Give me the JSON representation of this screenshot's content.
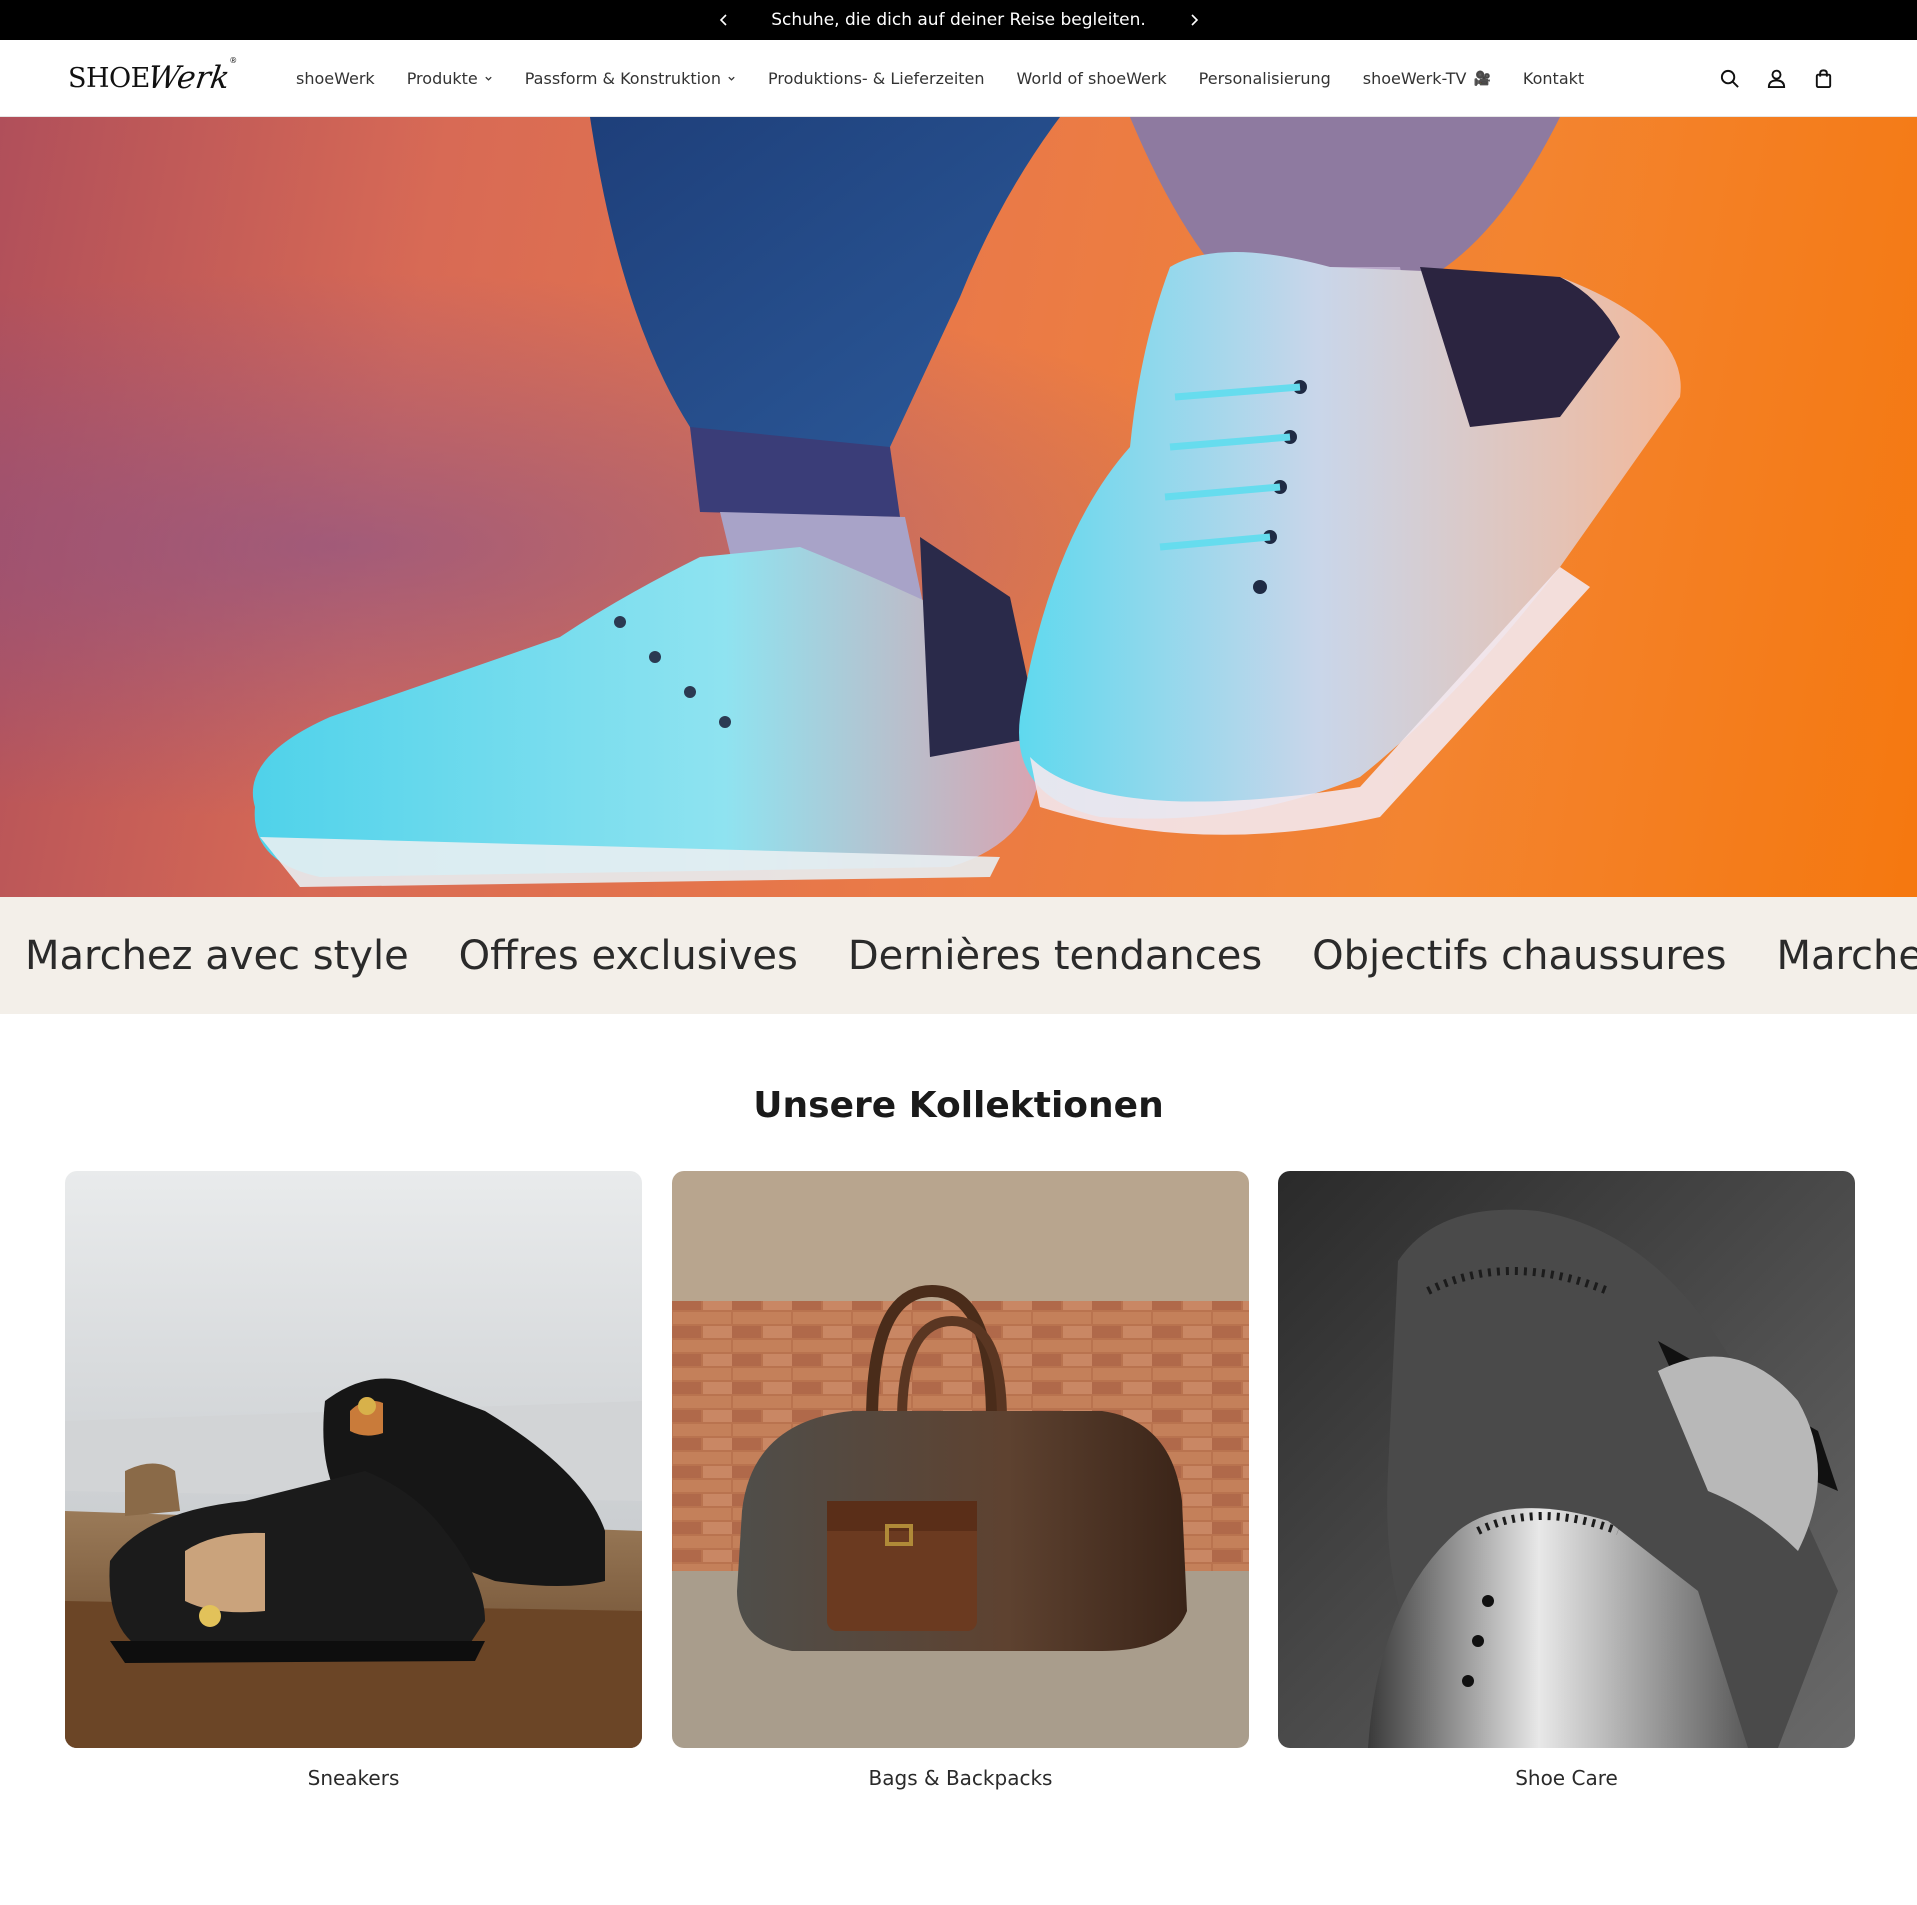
{
  "announcement": {
    "text": "Schuhe, die dich auf deiner Reise begleiten."
  },
  "header": {
    "logo_main": "SHOE",
    "logo_script": "Werk",
    "logo_mark": "®",
    "nav": [
      {
        "label": "shoeWerk",
        "dropdown": false
      },
      {
        "label": "Produkte",
        "dropdown": true
      },
      {
        "label": "Passform & Konstruktion",
        "dropdown": true
      },
      {
        "label": "Produktions- & Lieferzeiten",
        "dropdown": false
      },
      {
        "label": "World of shoeWerk",
        "dropdown": false
      },
      {
        "label": "Personalisierung",
        "dropdown": false
      },
      {
        "label": "shoeWerk-TV",
        "dropdown": false,
        "suffix_glyph": "🎥"
      },
      {
        "label": "Kontakt",
        "dropdown": false
      }
    ],
    "icons": [
      "search-icon",
      "account-icon",
      "cart-icon"
    ]
  },
  "marquee": {
    "items": [
      "Marchez avec style",
      "Offres exclusives",
      "Dernières tendances",
      "Objectifs chaussures",
      "Marchez avec style"
    ]
  },
  "collections": {
    "title": "Unsere Kollektionen",
    "items": [
      {
        "label": "Sneakers"
      },
      {
        "label": "Bags & Backpacks"
      },
      {
        "label": "Shoe Care"
      }
    ]
  },
  "colors": {
    "announcement_bg": "#000000",
    "marquee_bg": "#f3efe9",
    "hero_orange": "#f38430",
    "hero_teal": "#5fd6e8"
  }
}
